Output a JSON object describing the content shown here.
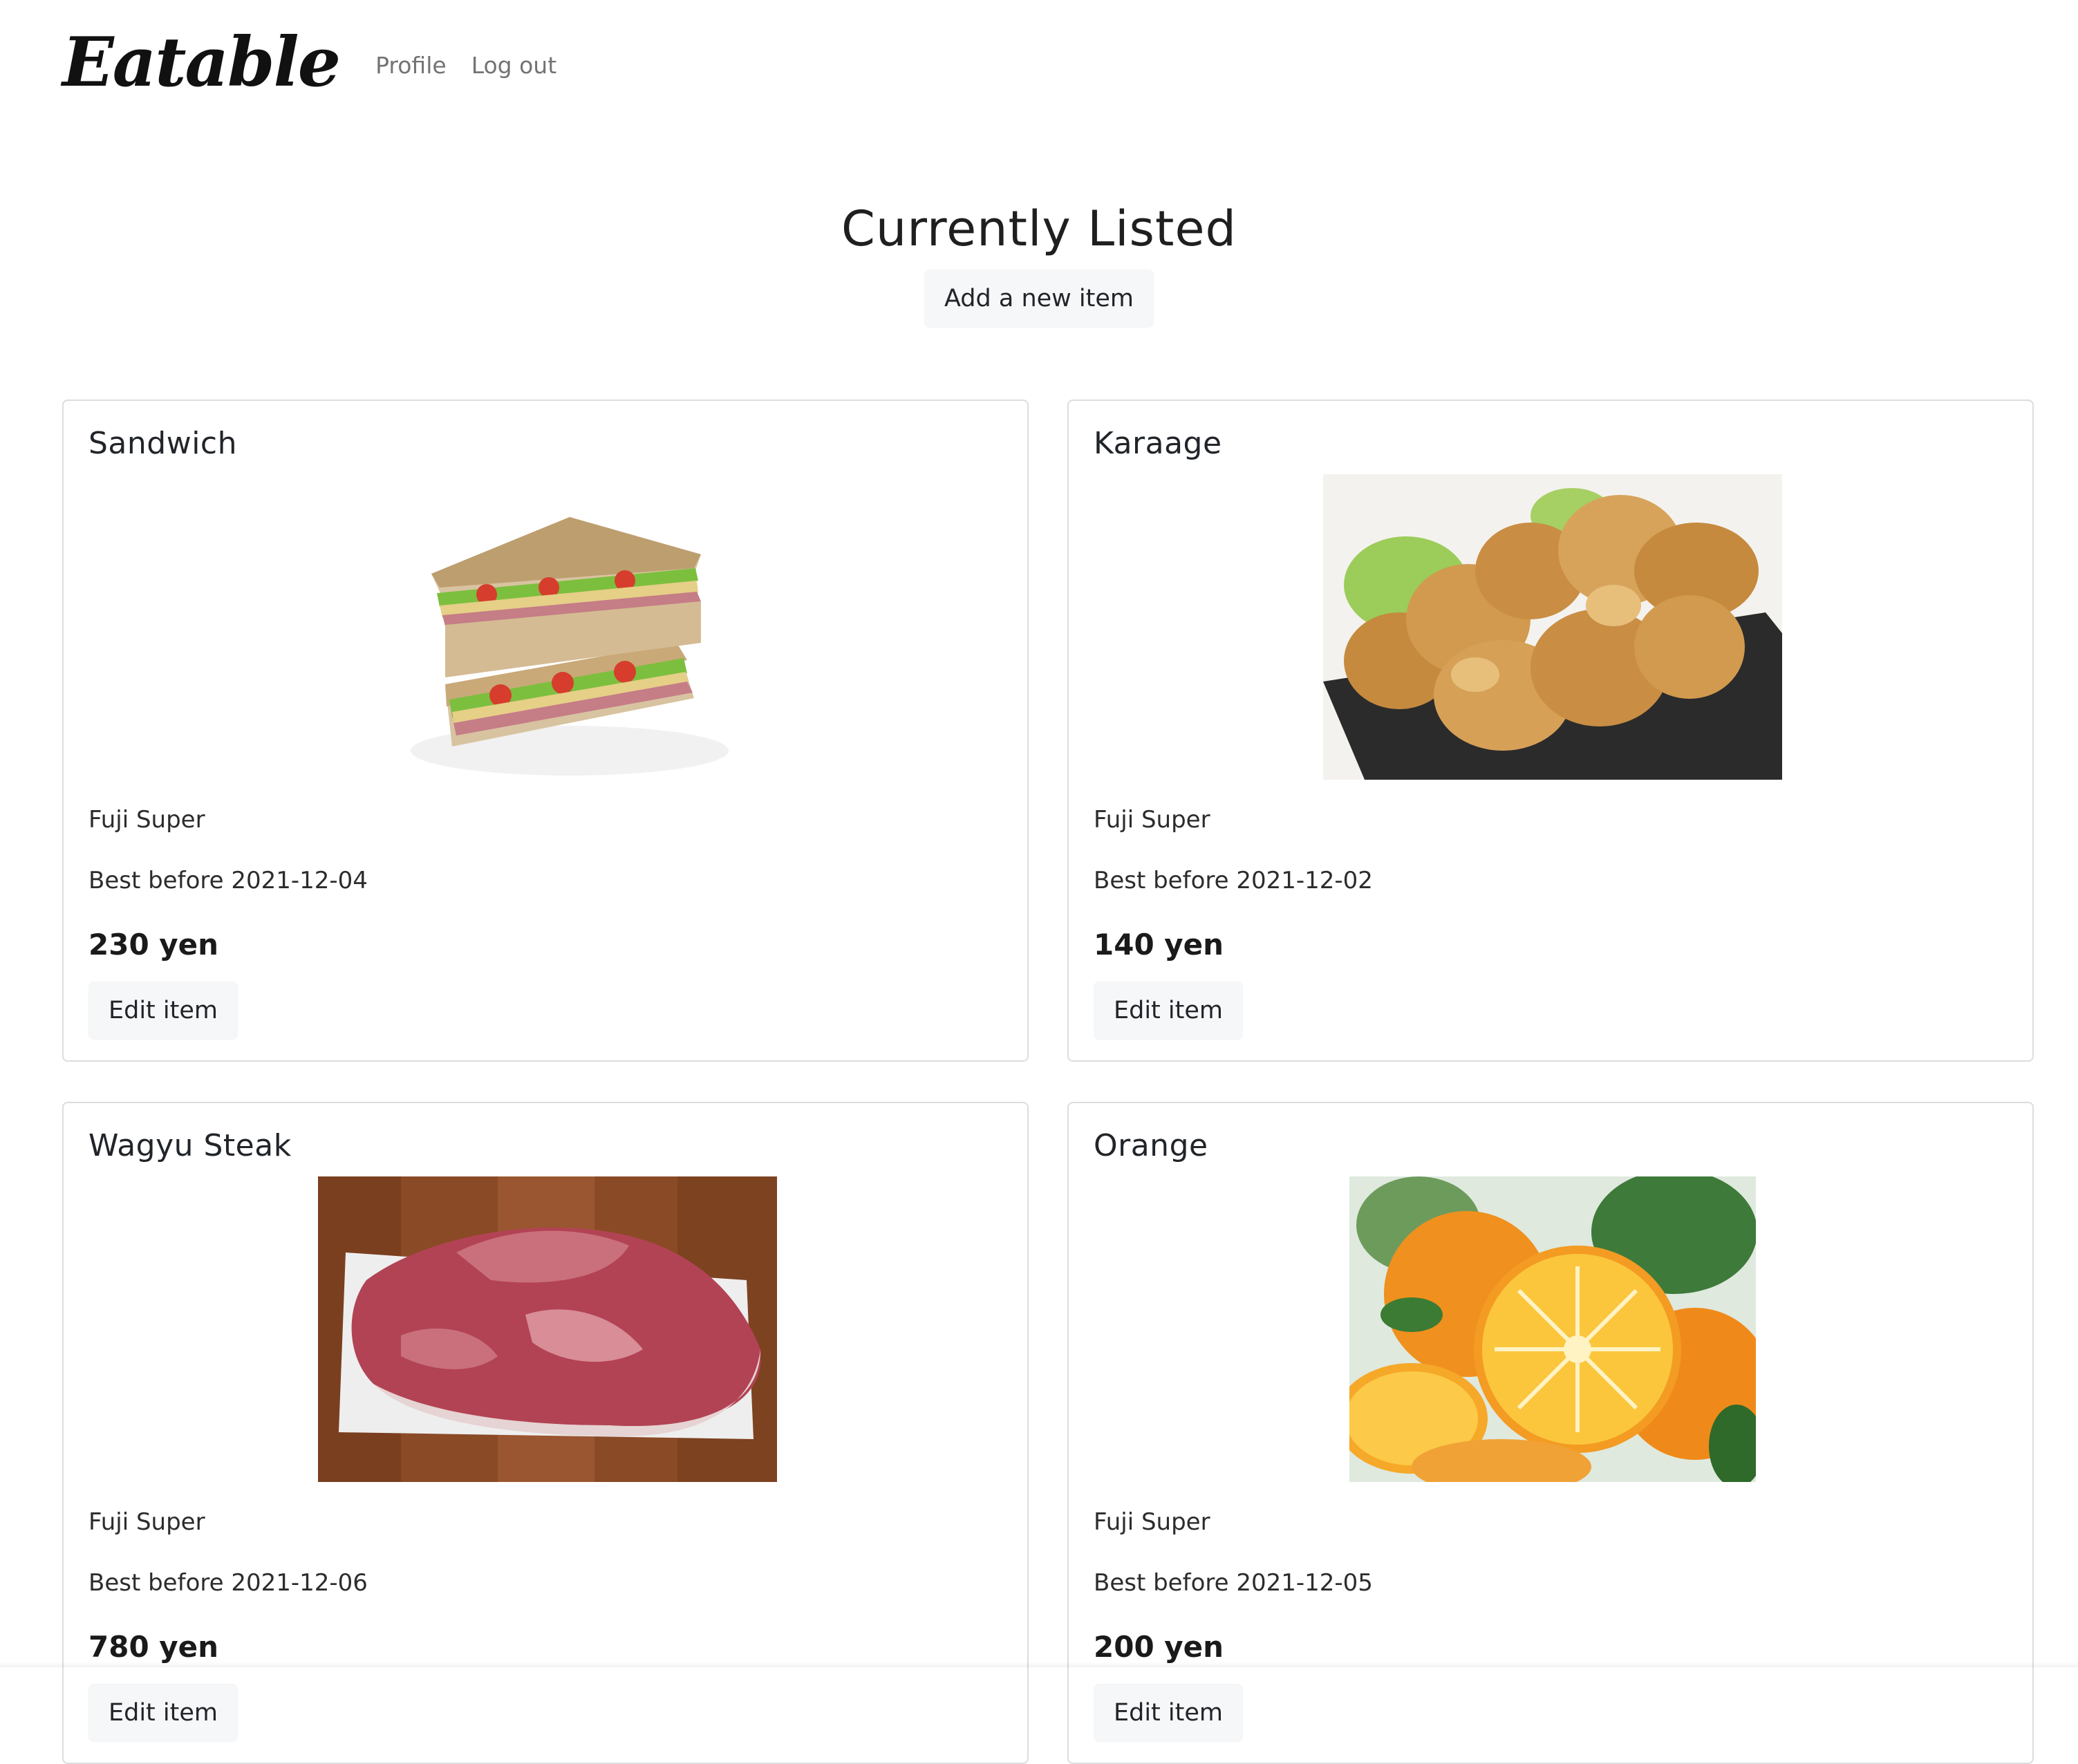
{
  "navbar": {
    "brand": "Eatable",
    "links": [
      "Profile",
      "Log out"
    ]
  },
  "header": {
    "title": "Currently Listed",
    "add_button": "Add a new item"
  },
  "items": [
    {
      "name": "Sandwich",
      "image": "sandwich-photo",
      "store": "Fuji Super",
      "best_before": "Best before 2021-12-04",
      "price": "230 yen",
      "edit_label": "Edit item"
    },
    {
      "name": "Karaage",
      "image": "karaage-photo",
      "store": "Fuji Super",
      "best_before": "Best before 2021-12-02",
      "price": "140 yen",
      "edit_label": "Edit item"
    },
    {
      "name": "Wagyu Steak",
      "image": "steak-photo",
      "store": "Fuji Super",
      "best_before": "Best before 2021-12-06",
      "price": "780 yen",
      "edit_label": "Edit item"
    },
    {
      "name": "Orange",
      "image": "orange-photo",
      "store": "Fuji Super",
      "best_before": "Best before 2021-12-05",
      "price": "200 yen",
      "edit_label": "Edit item"
    }
  ]
}
